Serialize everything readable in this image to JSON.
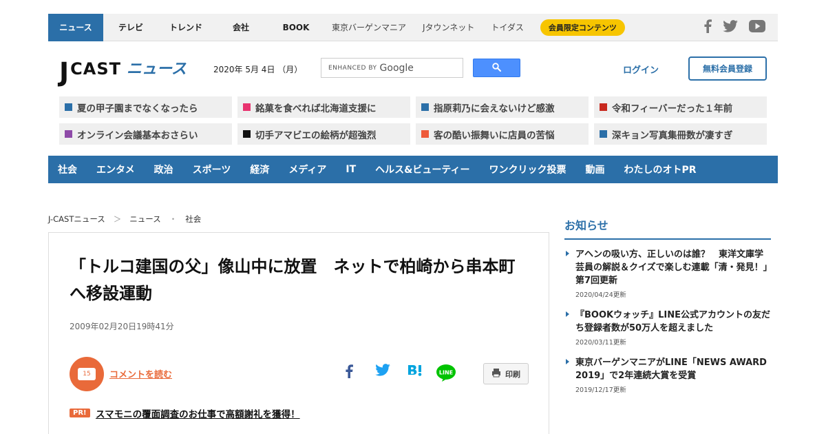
{
  "topnav": {
    "active": "ニュース",
    "items": [
      "テレビ",
      "トレンド",
      "会社",
      "BOOK"
    ],
    "small_items": [
      "東京バーゲンマニア",
      "Jタウンネット",
      "トイダス"
    ],
    "members_badge": "会員限定コンテンツ",
    "social_icons": [
      "facebook-icon",
      "twitter-icon",
      "youtube-icon"
    ]
  },
  "header": {
    "logo_j": "J",
    "logo_cast": "CAST",
    "logo_news": "ニュース",
    "date": "2020年 5月 4日 （月）",
    "search_enhanced": "ENHANCED BY",
    "search_google": "Google",
    "login": "ログイン",
    "register": "無料会員登録"
  },
  "tags": [
    {
      "label": "夏の甲子園までなくなったら",
      "color": "#2b6fa8"
    },
    {
      "label": "銘菓を食べれば北海道支援に",
      "color": "#e8336f"
    },
    {
      "label": "指原莉乃に会えないけど感激",
      "color": "#2b6fa8"
    },
    {
      "label": "令和フィーバーだった１年前",
      "color": "#c8281e"
    },
    {
      "label": "オンライン会議基本おさらい",
      "color": "#8e4aa8"
    },
    {
      "label": "切手アマビエの絵柄が超強烈",
      "color": "#111111"
    },
    {
      "label": "客の酷い振舞いに店員の苦悩",
      "color": "#ee5a3a"
    },
    {
      "label": "深キョン写真集冊数が凄すぎ",
      "color": "#2b6fa8"
    }
  ],
  "categories": [
    "社会",
    "エンタメ",
    "政治",
    "スポーツ",
    "経済",
    "メディア",
    "IT",
    "ヘルス&ビューティー",
    "ワンクリック投票",
    "動画",
    "わたしのオトPR"
  ],
  "breadcrumb": [
    "J-CASTニュース",
    "＞",
    "ニュース",
    "・",
    "社会"
  ],
  "article": {
    "title": "「トルコ建国の父」像山中に放置　ネットで柏崎から串本町へ移設運動",
    "date": "2009年02月20日19時41分",
    "comment_count": "15",
    "comment_link": "コメントを読む",
    "print": "印刷",
    "pr_badge": "PR!",
    "pr_link": "スマモニの覆面調査のお仕事で高額謝礼を獲得！"
  },
  "sidebar": {
    "heading": "お知らせ",
    "items": [
      {
        "text": "アヘンの吸い方、正しいのは誰？　東洋文庫学芸員の解説＆クイズで楽しむ連載「清・発見！」第7回更新",
        "date": "2020/04/24更新"
      },
      {
        "text": "『BOOKウォッチ』LINE公式アカウントの友だち登録者数が50万人を超えました",
        "date": "2020/03/11更新"
      },
      {
        "text": "東京バーゲンマニアがLINE「NEWS AWARD 2019」で2年連続大賞を受賞",
        "date": "2019/12/17更新"
      }
    ]
  }
}
